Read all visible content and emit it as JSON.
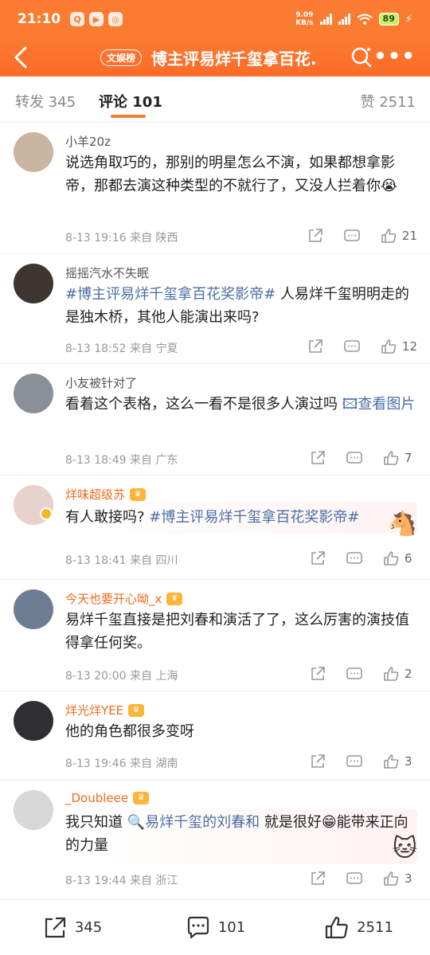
{
  "status_bar": {
    "time": "21:10",
    "speed_value": "9.09",
    "speed_unit": "KB/s",
    "battery": "89"
  },
  "nav": {
    "tag": "文娱榜",
    "title": "博主评易烊千玺拿百花..."
  },
  "tabs": {
    "repost": "转发 345",
    "comments": "评论 101",
    "likes": "赞 2511"
  },
  "comments": [
    {
      "user": "小羊20z",
      "text": "说选角取巧的，那别的明星怎么不演，如果都想拿影帝，那都去演这种类型的不就行了，又没人拦着你😭",
      "meta": "8-13 19:16  来自 陕西",
      "likes": "21"
    },
    {
      "user": "摇摇汽水不失眠",
      "hashtag": "#博主评易烊千玺拿百花奖影帝#",
      "text": " 人易烊千玺明明走的是独木桥，其他人能演出来吗?",
      "meta": "8-13 18:52  来自 宁夏",
      "likes": "12"
    },
    {
      "user": "小友被针对了",
      "text": "看着这个表格，这么一看不是很多人演过吗 ",
      "link": "🖾查看图片",
      "meta": "8-13 18:49  来自 广东",
      "likes": "7"
    },
    {
      "user": "烊味超级苏",
      "text": "有人敢接吗? ",
      "hashtag": "#博主评易烊千玺拿百花奖影帝#",
      "meta": "8-13 18:41  来自 四川",
      "likes": "6"
    },
    {
      "user": "今天也要开心呦_x",
      "text": "易烊千玺直接是把刘春和演活了了，这么厉害的演技值得拿任何奖。",
      "meta": "8-13 20:00  来自 上海",
      "likes": "2"
    },
    {
      "user": "烊光烊YEE",
      "text": "他的角色都很多变呀",
      "meta": "8-13 19:46  来自 湖南",
      "likes": "3"
    },
    {
      "user": "_Doubleee",
      "text_before": "我只知道 ",
      "link": "🔍易烊千玺的刘春和",
      "text_after": " 就是很好😁能带来正向的力量",
      "meta": "8-13 19:44  来自 浙江",
      "likes": "3"
    }
  ],
  "bottom_bar": {
    "reposts": "345",
    "comments": "101",
    "likes": "2511"
  },
  "icons": [
    "back-icon",
    "search-icon",
    "more-icon",
    "share-icon",
    "comment-icon",
    "like-icon"
  ],
  "colors": {
    "accent": "#fb7b30",
    "link": "#4a6fa5",
    "member_name": "#f26b1c"
  }
}
